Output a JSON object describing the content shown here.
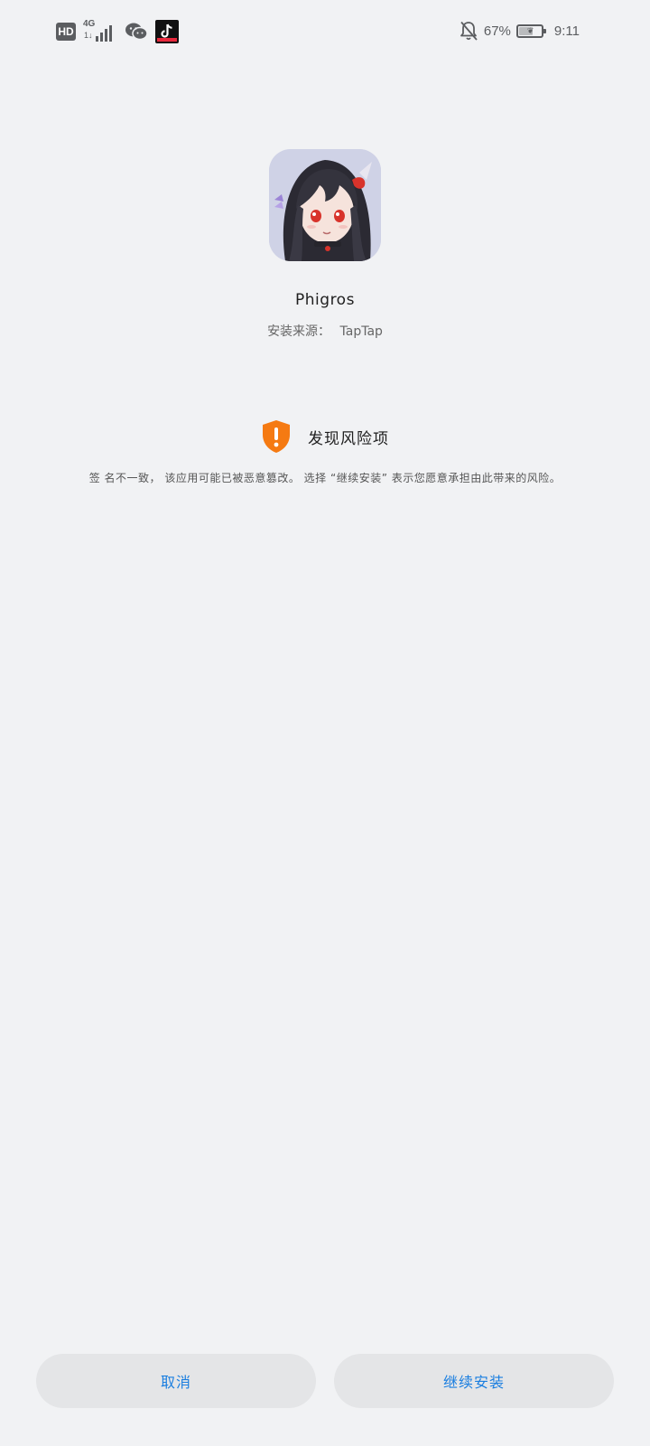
{
  "status_bar": {
    "hd_badge": "HD",
    "network_type": "4G",
    "network_arrows": "1↓",
    "battery_percent": "67%",
    "battery_level": 0.67,
    "time": "9:11",
    "icons": [
      "hd-icon",
      "4g-signal-icon",
      "wechat-icon",
      "tiktok-icon",
      "notifications-muted-icon",
      "battery-icon"
    ]
  },
  "app": {
    "name": "Phigros",
    "source_label": "安装来源：",
    "source_value": "TapTap"
  },
  "risk": {
    "title": "发现风险项",
    "description": "签 名不一致， 该应用可能已被恶意篡改。 选择 “继续安装” 表示您愿意承担由此带来的风险。",
    "icon": "warning-shield-icon",
    "color": "#f57a12"
  },
  "buttons": {
    "cancel_label": "取消",
    "continue_label": "继续安装",
    "accent_color": "#1a7ee0"
  }
}
